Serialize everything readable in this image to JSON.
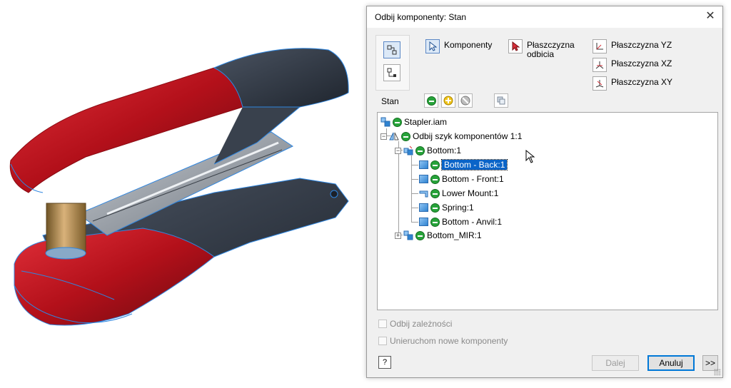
{
  "dialog": {
    "title": "Odbij komponenty: Stan",
    "close_glyph": "✕",
    "options": {
      "components": "Komponenty",
      "mirror_plane": "Płaszczyzna odbicia",
      "plane_yz": "Płaszczyzna YZ",
      "plane_xz": "Płaszczyzna XZ",
      "plane_xy": "Płaszczyzna XY"
    },
    "stan_label": "Stan",
    "tree": {
      "root": "Stapler.iam",
      "mirror_pattern": "Odbij szyk komponentów 1:1",
      "bottom": "Bottom:1",
      "children": [
        "Bottom - Back:1",
        "Bottom - Front:1",
        "Lower Mount:1",
        "Spring:1",
        "Bottom - Anvil:1"
      ],
      "bottom_mir": "Bottom_MIR:1",
      "selected": "Bottom - Back:1"
    },
    "checkboxes": {
      "mirror_relationships": "Odbij zależności",
      "ground_new": "Unieruchom nowe komponenty"
    },
    "buttons": {
      "next": "Dalej",
      "cancel": "Anuluj",
      "more": ">>",
      "help": "?"
    }
  },
  "colors": {
    "stapler_red": "#b3101a",
    "stapler_dark": "#2b3340",
    "edge_blue": "#2f86e0",
    "selection": "#0a64c8",
    "status_include": "#27a33a",
    "status_adapt": "#f0c419"
  }
}
